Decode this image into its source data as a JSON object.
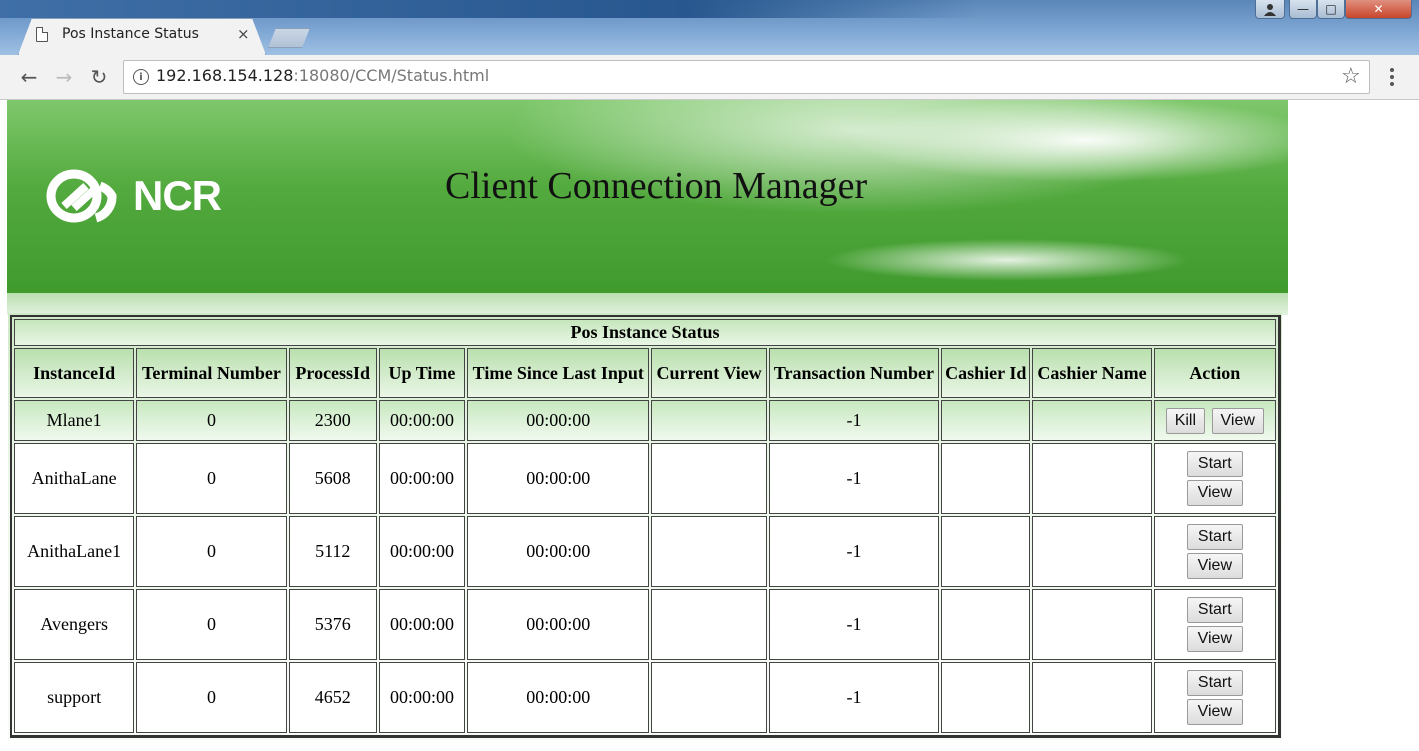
{
  "browser": {
    "tab_title": "Pos Instance Status",
    "tab_close": "×",
    "url_host": "192.168.154.128",
    "url_rest": ":18080/CCM/Status.html",
    "window_buttons": {
      "minimize": "—",
      "maximize": "□",
      "close": "✕"
    },
    "nav": {
      "back": "←",
      "forward": "→",
      "reload": "↻",
      "star": "☆"
    }
  },
  "banner": {
    "logo_text": "NCR",
    "title": "Client Connection Manager"
  },
  "table": {
    "caption": "Pos Instance Status",
    "headers": [
      "InstanceId",
      "Terminal Number",
      "ProcessId",
      "Up Time",
      "Time Since Last Input",
      "Current View",
      "Transaction Number",
      "Cashier Id",
      "Cashier Name",
      "Action"
    ],
    "rows": [
      {
        "instance_id": "Mlane1",
        "terminal": "0",
        "process_id": "2300",
        "up_time": "00:00:00",
        "since_input": "00:00:00",
        "current_view": "",
        "transaction": "-1",
        "cashier_id": "",
        "cashier_name": "",
        "action_1": "Kill",
        "action_2": "View"
      },
      {
        "instance_id": "AnithaLane",
        "terminal": "0",
        "process_id": "5608",
        "up_time": "00:00:00",
        "since_input": "00:00:00",
        "current_view": "",
        "transaction": "-1",
        "cashier_id": "",
        "cashier_name": "",
        "action_1": "Start",
        "action_2": "View"
      },
      {
        "instance_id": "AnithaLane1",
        "terminal": "0",
        "process_id": "5112",
        "up_time": "00:00:00",
        "since_input": "00:00:00",
        "current_view": "",
        "transaction": "-1",
        "cashier_id": "",
        "cashier_name": "",
        "action_1": "Start",
        "action_2": "View"
      },
      {
        "instance_id": "Avengers",
        "terminal": "0",
        "process_id": "5376",
        "up_time": "00:00:00",
        "since_input": "00:00:00",
        "current_view": "",
        "transaction": "-1",
        "cashier_id": "",
        "cashier_name": "",
        "action_1": "Start",
        "action_2": "View"
      },
      {
        "instance_id": "support",
        "terminal": "0",
        "process_id": "4652",
        "up_time": "00:00:00",
        "since_input": "00:00:00",
        "current_view": "",
        "transaction": "-1",
        "cashier_id": "",
        "cashier_name": "",
        "action_1": "Start",
        "action_2": "View"
      }
    ]
  },
  "colors": {
    "banner_green": "#53aa3e",
    "header_green": "#b9e0ae"
  }
}
